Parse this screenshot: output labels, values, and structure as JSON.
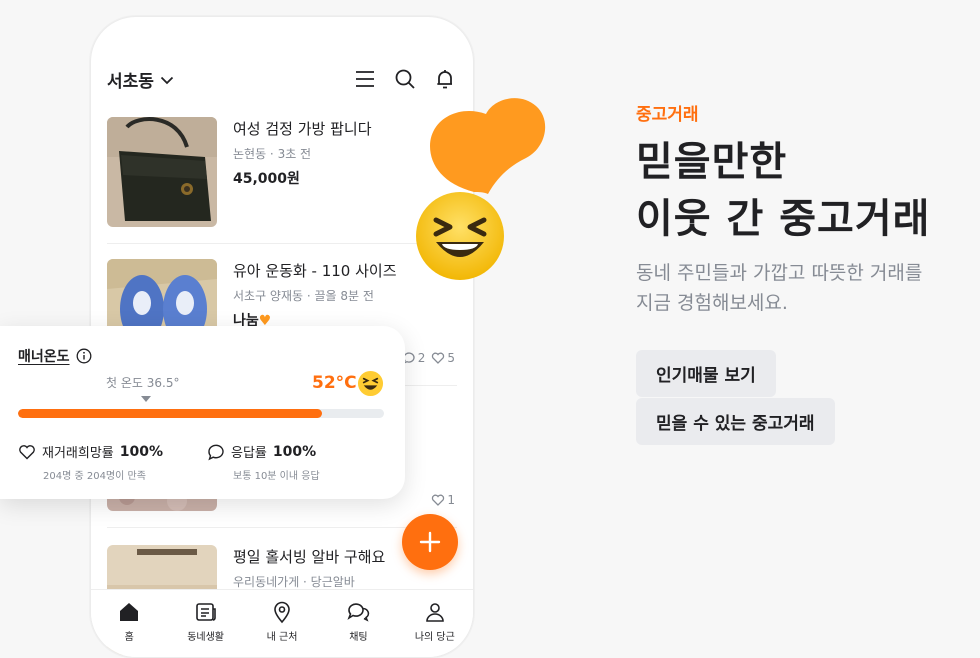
{
  "phone": {
    "location": "서초동",
    "items": [
      {
        "title": "여성 검정 가방 팝니다",
        "meta": "논현동 · 3초 전",
        "price": "45,000원"
      },
      {
        "title": "유아 운동화 - 110 사이즈",
        "meta": "서초구 양재동 · 끌올 8분 전",
        "price": "나눔"
      },
      {
        "title": "평일 홀서빙 알바 구해요",
        "meta": "우리동네가게 · 당근알바",
        "price": ""
      }
    ],
    "item2_stats": {
      "chats": "2",
      "likes": "5"
    },
    "item3_stats": {
      "likes": "1"
    },
    "tabs": [
      {
        "label": "홈"
      },
      {
        "label": "동네생활"
      },
      {
        "label": "내 근처"
      },
      {
        "label": "채팅"
      },
      {
        "label": "나의 당근"
      }
    ]
  },
  "manner_card": {
    "title": "매너온도",
    "first_temp": "첫 온도 36.5°",
    "temperature": "52°C",
    "temperature_fraction": 0.83,
    "rehire": {
      "label": "재거래희망률",
      "value": "100%",
      "sub": "204명 중 204명이 만족"
    },
    "response": {
      "label": "응답률",
      "value": "100%",
      "sub": "보통 10분 이내 응답"
    }
  },
  "hero": {
    "category": "중고거래",
    "headline_line1": "믿을만한",
    "headline_line2": "이웃 간 중고거래",
    "desc_line1": "동네 주민들과 가깝고 따뜻한 거래를",
    "desc_line2": "지금 경험해보세요.",
    "chips": [
      "인기매물 보기",
      "믿을 수 있는 중고거래"
    ]
  },
  "colors": {
    "accent": "#ff6f0f",
    "text": "#212124",
    "muted": "#868b94",
    "chip_bg": "#eaebee",
    "emoji": "#ffd23f",
    "heart": "#ff9a1f"
  },
  "icons": [
    "chevron-down-icon",
    "menu-icon",
    "search-icon",
    "bell-icon",
    "chat-icon",
    "heart-icon",
    "info-icon",
    "plus-icon",
    "home-icon",
    "news-icon",
    "location-icon",
    "chats-icon",
    "user-icon"
  ]
}
